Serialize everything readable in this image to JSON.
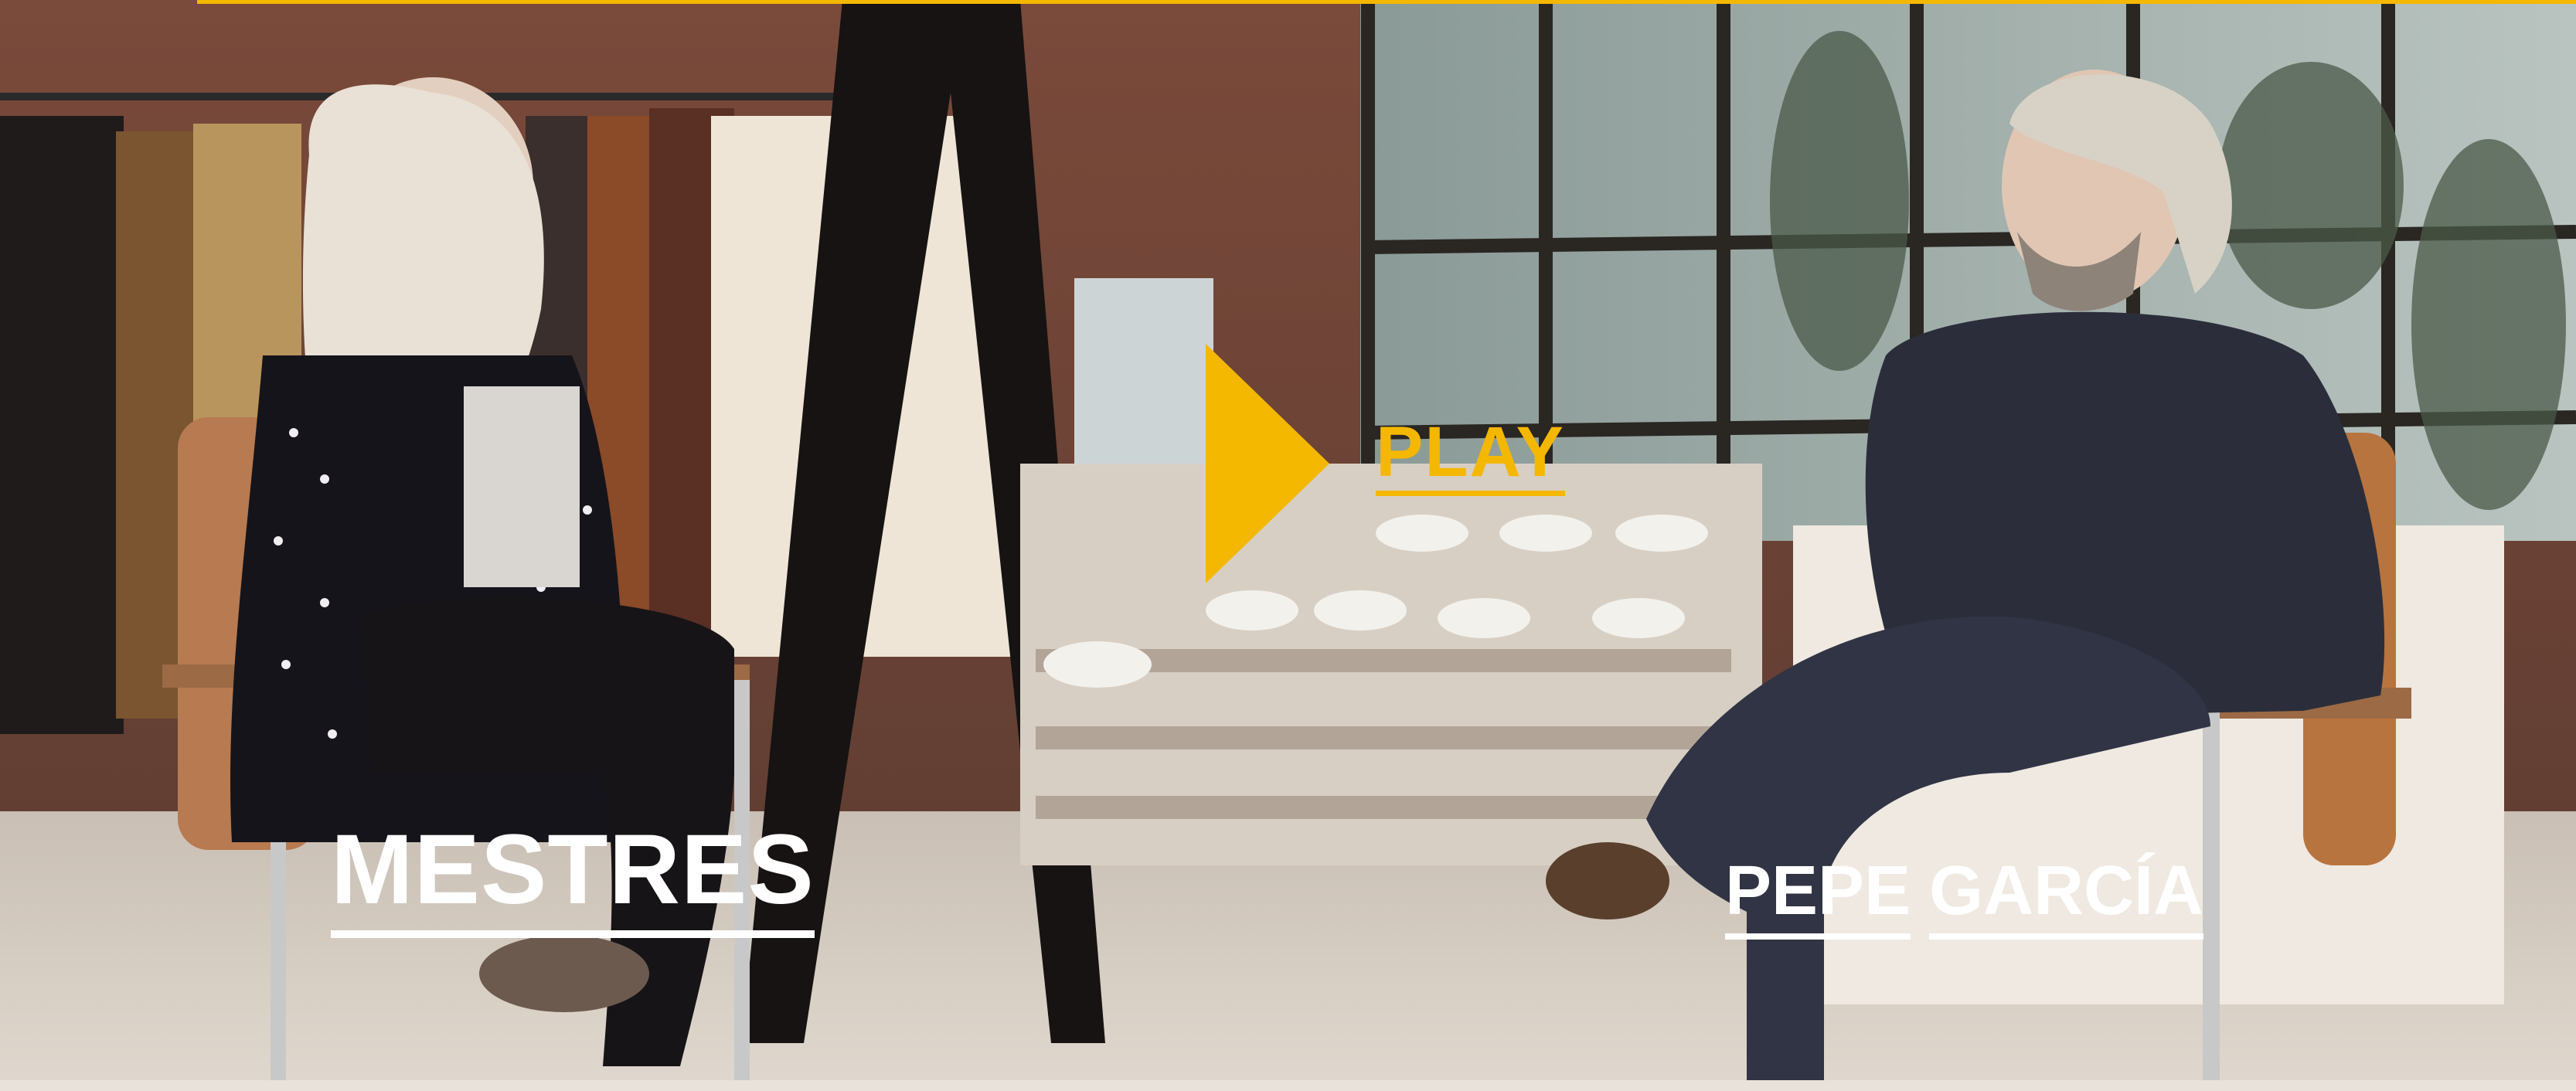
{
  "video": {
    "play_label": "PLAY",
    "play_icon": "play-triangle-icon",
    "accent_color": "#f5b800"
  },
  "captions": {
    "left_name": "MESTRES",
    "right_first_name": "PEPE",
    "right_last_name": "GARCÍA"
  }
}
